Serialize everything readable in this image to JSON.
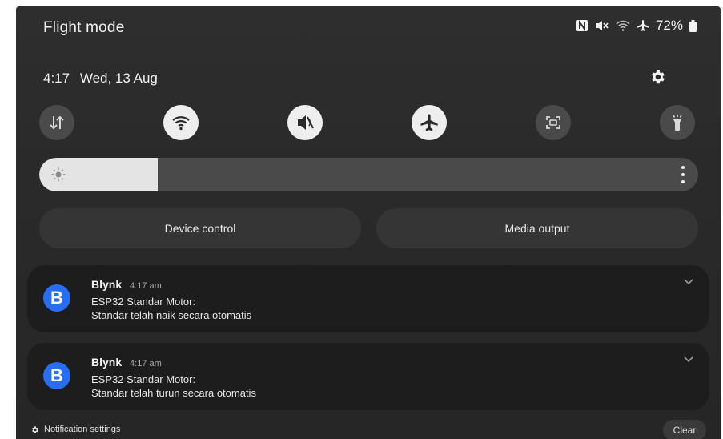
{
  "status_bar": {
    "title": "Flight mode",
    "battery": "72%",
    "icons": [
      "nfc-icon",
      "mute-icon",
      "wifi-icon",
      "airplane-icon",
      "battery-icon"
    ]
  },
  "header": {
    "time": "4:17",
    "date": "Wed, 13 Aug",
    "settings_icon": "gear-icon"
  },
  "quick_settings": [
    {
      "name": "mobile-data",
      "icon": "data-arrows-icon",
      "state": "off"
    },
    {
      "name": "wifi",
      "icon": "wifi-icon",
      "state": "on"
    },
    {
      "name": "sound",
      "icon": "mute-icon",
      "state": "on"
    },
    {
      "name": "airplane-mode",
      "icon": "airplane-icon",
      "state": "on"
    },
    {
      "name": "screen-capture",
      "icon": "screen-capture-icon",
      "state": "off"
    },
    {
      "name": "flashlight",
      "icon": "flashlight-icon",
      "state": "off"
    }
  ],
  "brightness": {
    "level_fraction": 0.18,
    "icon": "sun-icon"
  },
  "controls": {
    "device_control": "Device control",
    "media_output": "Media output"
  },
  "notifications": [
    {
      "app_icon_letter": "B",
      "app": "Blynk",
      "time": "4:17 am",
      "line1": "ESP32 Standar Motor:",
      "line2": "Standar telah naik secara otomatis"
    },
    {
      "app_icon_letter": "B",
      "app": "Blynk",
      "time": "4:17 am",
      "line1": "ESP32 Standar Motor:",
      "line2": "Standar telah turun secara otomatis"
    }
  ],
  "footer": {
    "notification_settings": "Notification settings",
    "clear": "Clear"
  },
  "colors": {
    "panel_bg": "#2b2b2b",
    "tile_on": "#eeeeee",
    "tile_off": "#4a4a4a",
    "accent_blue": "#2a6ef0"
  }
}
